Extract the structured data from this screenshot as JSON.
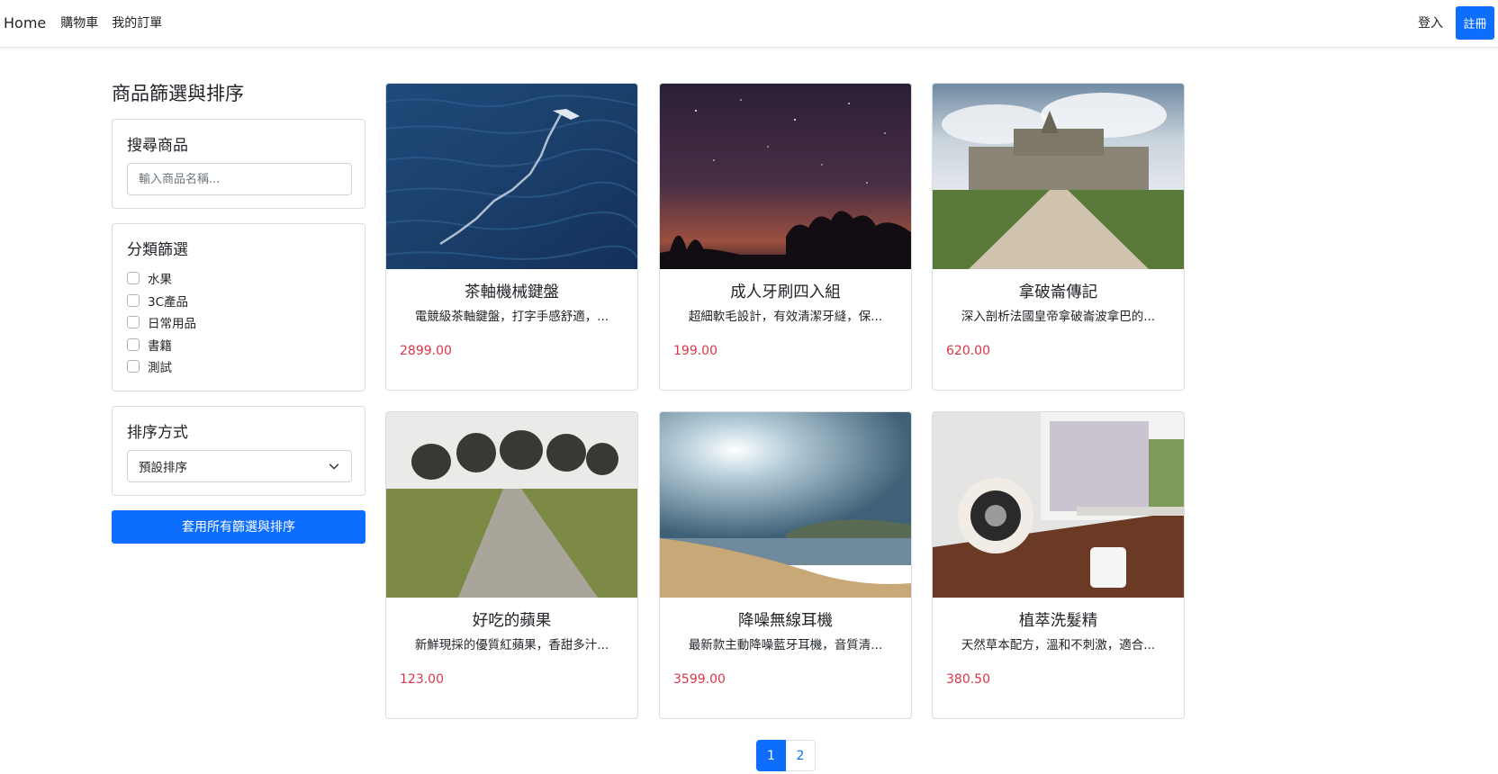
{
  "nav": {
    "home": "Home",
    "cart": "購物車",
    "orders": "我的訂單",
    "login": "登入",
    "register": "註冊"
  },
  "sidebar": {
    "title": "商品篩選與排序",
    "search": {
      "title": "搜尋商品",
      "placeholder": "輸入商品名稱..."
    },
    "category": {
      "title": "分類篩選",
      "items": [
        "水果",
        "3C產品",
        "日常用品",
        "書籍",
        "測試"
      ]
    },
    "sort": {
      "title": "排序方式",
      "selected": "預設排序"
    },
    "apply_label": "套用所有篩選與排序"
  },
  "products": [
    {
      "name": "茶軸機械鍵盤",
      "desc": "電競級茶軸鍵盤，打字手感舒適，...",
      "price": "2899.00",
      "image": "ocean-bird-photo"
    },
    {
      "name": "成人牙刷四入組",
      "desc": "超細軟毛設計，有效清潔牙縫，保...",
      "price": "199.00",
      "image": "night-sky-trees-photo"
    },
    {
      "name": "拿破崙傳記",
      "desc": "深入剖析法國皇帝拿破崙波拿巴的...",
      "price": "620.00",
      "image": "castle-path-photo"
    },
    {
      "name": "好吃的蘋果",
      "desc": "新鮮現採的優質紅蘋果，香甜多汁...",
      "price": "123.00",
      "image": "tree-path-photo"
    },
    {
      "name": "降噪無線耳機",
      "desc": "最新款主動降噪藍牙耳機，音質清...",
      "price": "3599.00",
      "image": "beach-sun-photo"
    },
    {
      "name": "植萃洗髮精",
      "desc": "天然草本配方，溫和不刺激，適合...",
      "price": "380.50",
      "image": "desk-speaker-photo"
    }
  ],
  "pagination": {
    "pages": [
      "1",
      "2"
    ],
    "current": "1"
  },
  "colors": {
    "primary": "#0d6efd",
    "price": "#dc3545"
  }
}
